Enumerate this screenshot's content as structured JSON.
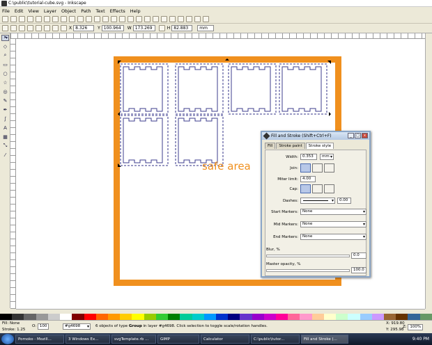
{
  "window": {
    "title": "C:\\public\\tutorial-cube.svg - Inkscape"
  },
  "menu": [
    "File",
    "Edit",
    "View",
    "Layer",
    "Object",
    "Path",
    "Text",
    "Effects",
    "Help"
  ],
  "toolbar2": {
    "x_label": "X",
    "x_value": "8.326",
    "y_label": "Y",
    "y_value": "100.964",
    "w_label": "W",
    "w_value": "173.269",
    "h_label": "H",
    "h_value": "82.883",
    "unit": "mm"
  },
  "canvas": {
    "safe_area_label": "safe area",
    "page_border_color": "#f0901e"
  },
  "dialog": {
    "title": "Fill and Stroke (Shift+Ctrl+F)",
    "tabs": [
      "Fill",
      "Stroke paint",
      "Stroke style"
    ],
    "width_label": "Width:",
    "width_value": "0.353",
    "width_unit": "mm",
    "join_label": "Join:",
    "miter_label": "Miter limit:",
    "miter_value": "4.00",
    "cap_label": "Cap:",
    "dashes_label": "Dashes:",
    "dashes_value": "0.00",
    "start_markers_label": "Start Markers:",
    "start_markers_value": "None",
    "mid_markers_label": "Mid Markers:",
    "mid_markers_value": "None",
    "end_markers_label": "End Markers:",
    "end_markers_value": "None",
    "blur_label": "Blur, %",
    "blur_value": "0.0",
    "opacity_label": "Master opacity, %",
    "opacity_value": "100.0"
  },
  "status": {
    "fill_label": "Fill:",
    "fill_value": "None",
    "stroke_label": "Stroke:",
    "stroke_width": "1.25",
    "opacity_label": "O:",
    "opacity_value": "100",
    "layer_value": "#g4698",
    "message_pre": "6 objects of type ",
    "message_bold": "Group",
    "message_post": " in layer #g4698. Click selection to toggle scale/rotation handles.",
    "x_label": "X:",
    "x_value": "919.80",
    "y_label": "Y:",
    "y_value": "295.98",
    "zoom_label": "Z:",
    "zoom_value": "100%"
  },
  "taskbar": {
    "items": [
      "Pomoko - Mozill...",
      "3 Windows Ex...",
      "svgTemplate.rb ...",
      "GIMP",
      "Calculator",
      "C:\\public\\tutor...",
      "Fill and Stroke (..."
    ],
    "clock": "9:40 PM"
  }
}
